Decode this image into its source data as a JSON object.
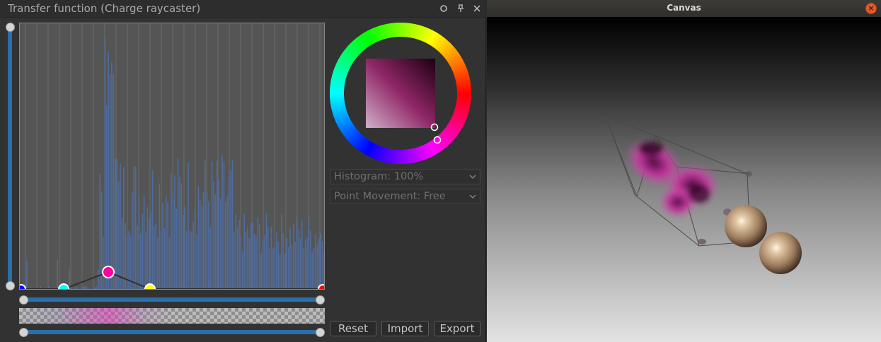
{
  "transfer_function_window": {
    "title": "Transfer function (Charge raycaster)",
    "title_buttons": [
      {
        "icon": "float-icon"
      },
      {
        "icon": "pin-icon"
      },
      {
        "icon": "close-icon"
      }
    ],
    "histogram_dropdown": {
      "value": "Histogram: 100%"
    },
    "movement_dropdown": {
      "value": "Point Movement: Free"
    },
    "buttons": {
      "reset": "Reset",
      "import": "Import",
      "export": "Export"
    },
    "control_points": [
      {
        "name": "blue",
        "color": "#0000ff"
      },
      {
        "name": "cyan",
        "color": "#00ffff"
      },
      {
        "name": "magenta",
        "color": "#ff00a0"
      },
      {
        "name": "yellow",
        "color": "#ffff00"
      },
      {
        "name": "red",
        "color": "#ff0000"
      }
    ],
    "selected_color": "#ff00ff",
    "accent_color": "#2a6faa"
  },
  "canvas_window": {
    "title": "Canvas",
    "close_icon": "close-icon"
  }
}
